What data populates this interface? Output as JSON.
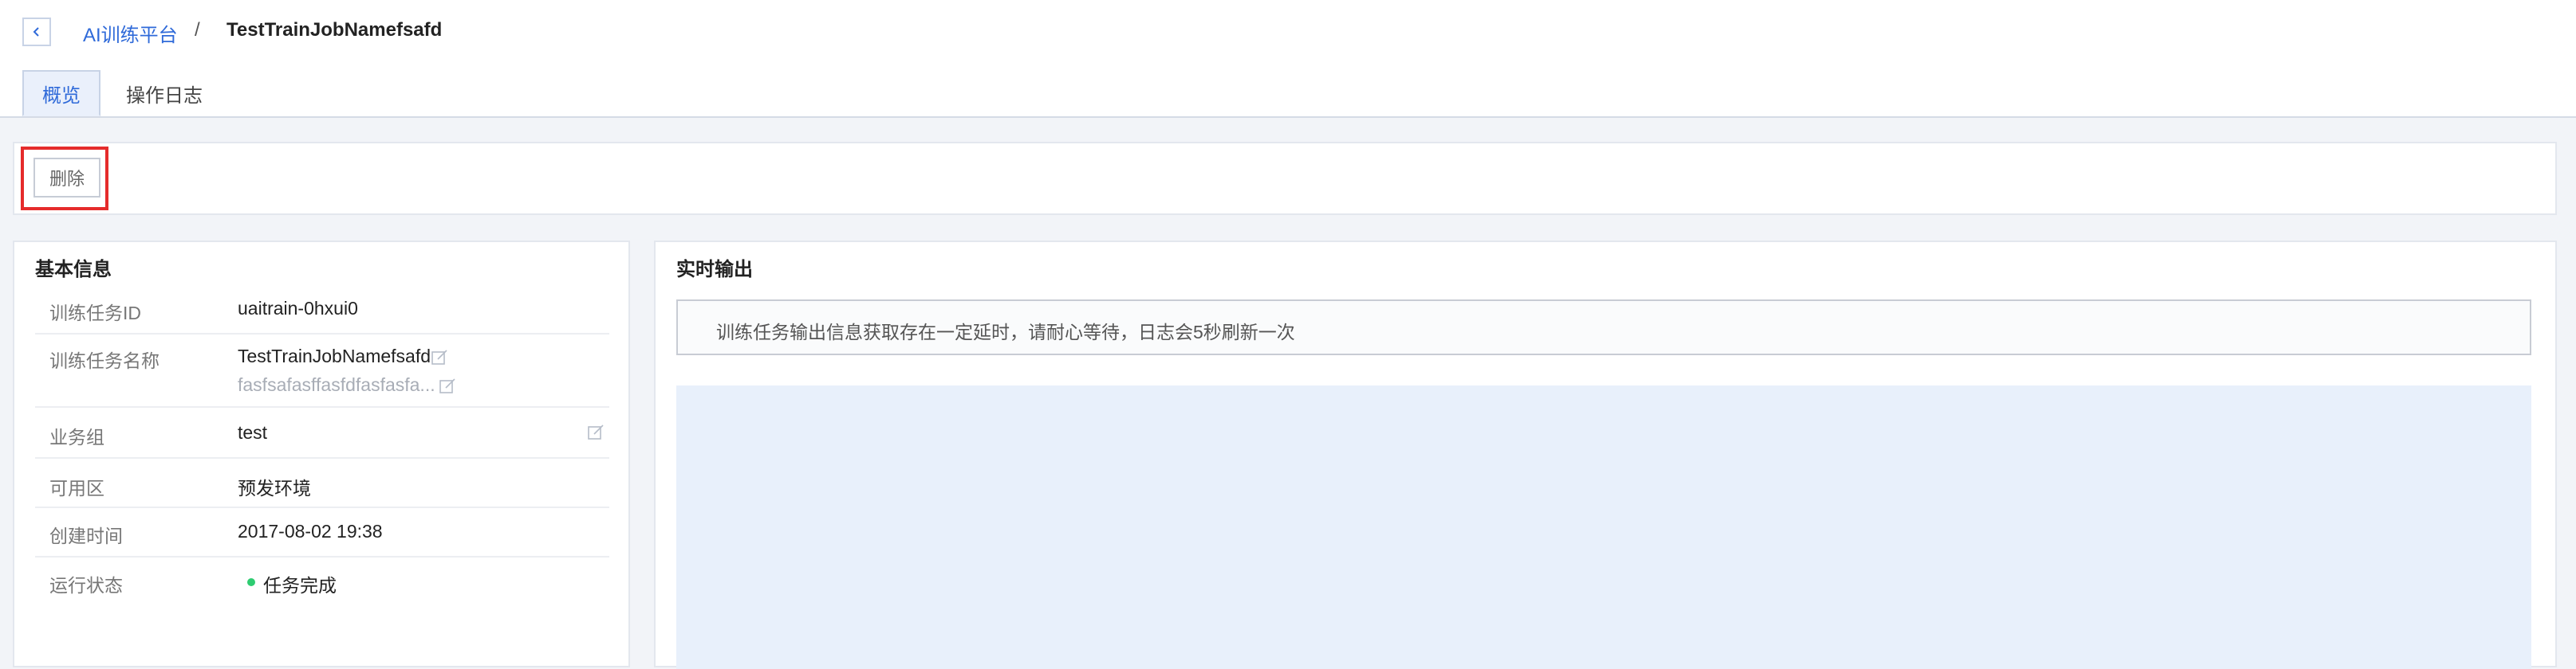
{
  "breadcrumb": {
    "parent": "AI训练平台",
    "separator": "/",
    "current": "TestTrainJobNamefsafd"
  },
  "tabs": [
    {
      "label": "概览",
      "active": true
    },
    {
      "label": "操作日志",
      "active": false
    }
  ],
  "toolbar": {
    "delete_label": "删除"
  },
  "basic_info": {
    "title": "基本信息",
    "rows": [
      {
        "label": "训练任务ID",
        "value": "uaitrain-0hxui0"
      },
      {
        "label": "训练任务名称",
        "value": "TestTrainJobNamefsafd",
        "sub_value": "fasfsafasffasfdfasfasfa..."
      },
      {
        "label": "业务组",
        "value": "test"
      },
      {
        "label": "可用区",
        "value": "预发环境"
      },
      {
        "label": "创建时间",
        "value": "2017-08-02 19:38"
      },
      {
        "label": "运行状态",
        "value": "任务完成"
      }
    ]
  },
  "realtime_output": {
    "title": "实时输出",
    "notice": "训练任务输出信息获取存在一定延时，请耐心等待，日志会5秒刷新一次"
  },
  "icons": {
    "back": "chevron-left-icon",
    "edit": "edit-icon",
    "status": "status-dot-icon"
  },
  "colors": {
    "accent": "#2f6ad9",
    "highlight": "#e52b2b",
    "status_success": "#2ecc71",
    "log_area": "#e8f0fb"
  }
}
